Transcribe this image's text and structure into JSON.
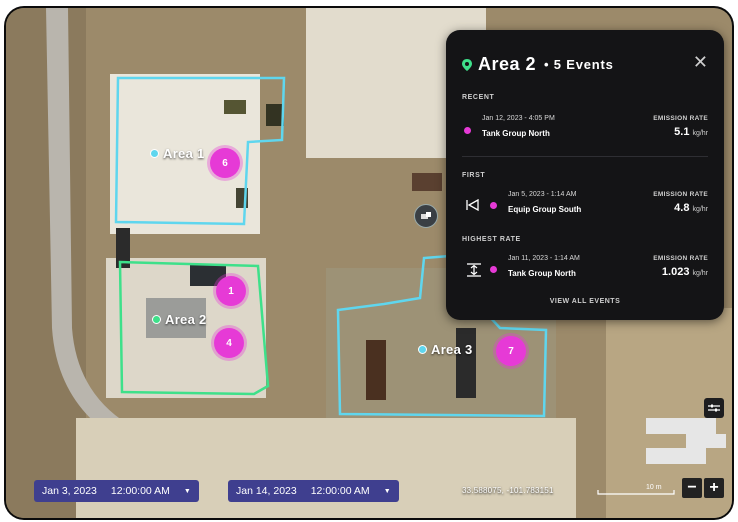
{
  "map": {
    "areas": [
      {
        "label": "Area 1",
        "pin_count": "6"
      },
      {
        "label": "Area 2",
        "pin_counts": [
          "1",
          "4"
        ]
      },
      {
        "label": "Area 3",
        "pin_count": "7"
      }
    ],
    "colors": {
      "area1": "#5fd6ee",
      "area2": "#3ee08a",
      "area3": "#5fd6ee",
      "pin": "#e63ad6"
    }
  },
  "panel": {
    "title": "Area 2",
    "subtitle": "• 5 Events",
    "close_icon": "close-icon",
    "sections": [
      {
        "label": "RECENT",
        "date": "Jan 12, 2023  -  4:05 PM",
        "name": "Tank Group North",
        "rate_label": "EMISSION RATE",
        "rate": "5.1",
        "unit": "kg/hr"
      },
      {
        "label": "FIRST",
        "date": "Jan 5, 2023  -  1:14 AM",
        "name": "Equip Group South",
        "rate_label": "EMISSION RATE",
        "rate": "4.8",
        "unit": "kg/hr"
      },
      {
        "label": "HIGHEST RATE",
        "date": "Jan 11, 2023  -  1:14 AM",
        "name": "Tank Group North",
        "rate_label": "EMISSION RATE",
        "rate": "1.023",
        "unit": "kg/hr"
      }
    ],
    "view_all": "VIEW ALL EVENTS"
  },
  "footer": {
    "start_date": "Jan 3, 2023",
    "start_time": "12:00:00 AM",
    "end_date": "Jan 14, 2023",
    "end_time": "12:00:00 AM",
    "coords": "33.588075,  -101.783151",
    "scale": "10 m",
    "zoom_out": "−",
    "zoom_in": "+"
  }
}
